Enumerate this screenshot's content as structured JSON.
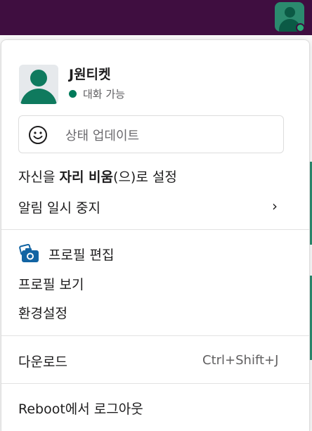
{
  "menu": {
    "user": {
      "name": "J원티켓",
      "status_text": "대화 가능"
    },
    "status_box": {
      "placeholder": "상태 업데이트",
      "icon": "smile-icon"
    },
    "away": {
      "prefix": "자신을 ",
      "bold": "자리 비움",
      "suffix": "(으)로 설정"
    },
    "pause_notifications": {
      "label": "알림 일시 중지",
      "chevron": "›"
    },
    "edit_profile": "프로필 편집",
    "view_profile": "프로필 보기",
    "preferences": "환경설정",
    "downloads": {
      "label": "다운로드",
      "shortcut": "Ctrl+Shift+J"
    },
    "sign_out": "Reboot에서 로그아웃"
  },
  "colors": {
    "topbar": "#3f0e40",
    "online": "#2bac76",
    "avatar_green": "#0f7a5e",
    "camera_blue": "#1264a3"
  }
}
